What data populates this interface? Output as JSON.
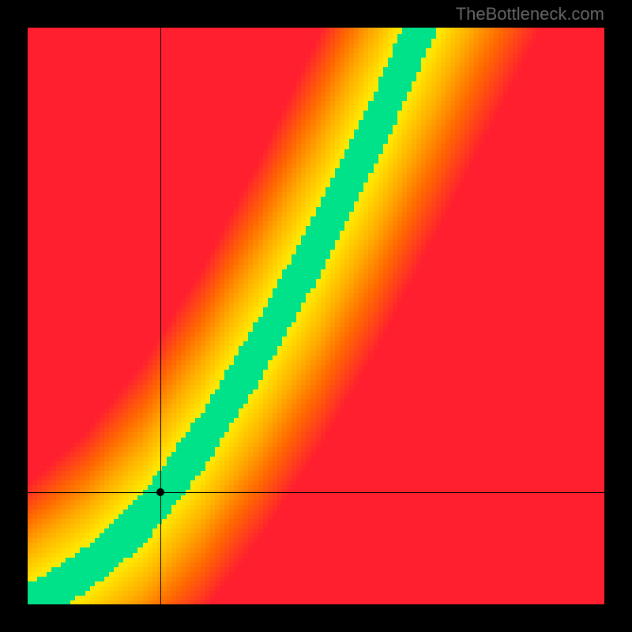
{
  "watermark": "TheBottleneck.com",
  "chart_data": {
    "type": "heatmap",
    "title": "",
    "xlabel": "",
    "ylabel": "",
    "x_range": [
      0,
      1
    ],
    "y_range": [
      0,
      1
    ],
    "crosshair": {
      "x": 0.23,
      "y": 0.195
    },
    "marker": {
      "x": 0.23,
      "y": 0.195
    },
    "optimal_curve_description": "Green band along a superlinear curve from origin to top-right; red in off-diagonal corners; smooth orange/yellow gradient between.",
    "optimal_curve_samples": [
      {
        "x": 0.0,
        "y": 0.0
      },
      {
        "x": 0.1,
        "y": 0.06
      },
      {
        "x": 0.2,
        "y": 0.15
      },
      {
        "x": 0.3,
        "y": 0.28
      },
      {
        "x": 0.4,
        "y": 0.44
      },
      {
        "x": 0.5,
        "y": 0.62
      },
      {
        "x": 0.6,
        "y": 0.82
      },
      {
        "x": 0.68,
        "y": 1.0
      }
    ],
    "color_stops": [
      {
        "t": 0.0,
        "color": "#00e28a"
      },
      {
        "t": 0.08,
        "color": "#c8f527"
      },
      {
        "t": 0.2,
        "color": "#ffe600"
      },
      {
        "t": 0.45,
        "color": "#ffae00"
      },
      {
        "t": 0.7,
        "color": "#ff6a00"
      },
      {
        "t": 1.0,
        "color": "#ff1f2f"
      }
    ],
    "grid_resolution": 120
  }
}
